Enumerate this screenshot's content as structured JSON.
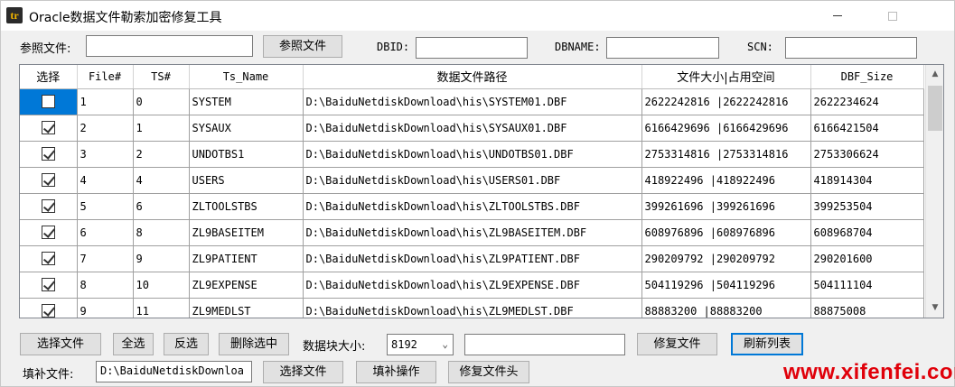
{
  "window": {
    "title": "Oracle数据文件勒索加密修复工具",
    "icon": "app-logo-icon",
    "min_label": "—",
    "max_label": "□"
  },
  "top_form": {
    "ref_file_label": "参照文件:",
    "ref_file_value": "",
    "ref_file_button": "参照文件",
    "dbid_label": "DBID:",
    "dbid_value": "",
    "dbname_label": "DBNAME:",
    "dbname_value": "",
    "scn_label": "SCN:",
    "scn_value": ""
  },
  "grid": {
    "columns": [
      "选择",
      "File#",
      "TS#",
      "Ts_Name",
      "数据文件路径",
      "文件大小|占用空间",
      "DBF_Size"
    ],
    "rows": [
      {
        "checked": false,
        "selected": true,
        "file": "1",
        "ts": "0",
        "ts_name": "SYSTEM",
        "path": "D:\\BaiduNetdiskDownload\\his\\SYSTEM01.DBF",
        "size": "2622242816 |2622242816",
        "dbf_size": "2622234624"
      },
      {
        "checked": true,
        "selected": false,
        "file": "2",
        "ts": "1",
        "ts_name": "SYSAUX",
        "path": "D:\\BaiduNetdiskDownload\\his\\SYSAUX01.DBF",
        "size": "6166429696 |6166429696",
        "dbf_size": "6166421504"
      },
      {
        "checked": true,
        "selected": false,
        "file": "3",
        "ts": "2",
        "ts_name": "UNDOTBS1",
        "path": "D:\\BaiduNetdiskDownload\\his\\UNDOTBS01.DBF",
        "size": "2753314816 |2753314816",
        "dbf_size": "2753306624"
      },
      {
        "checked": true,
        "selected": false,
        "file": "4",
        "ts": "4",
        "ts_name": "USERS",
        "path": "D:\\BaiduNetdiskDownload\\his\\USERS01.DBF",
        "size": "418922496 |418922496",
        "dbf_size": "418914304"
      },
      {
        "checked": true,
        "selected": false,
        "file": "5",
        "ts": "6",
        "ts_name": "ZLTOOLSTBS",
        "path": "D:\\BaiduNetdiskDownload\\his\\ZLTOOLSTBS.DBF",
        "size": "399261696 |399261696",
        "dbf_size": "399253504"
      },
      {
        "checked": true,
        "selected": false,
        "file": "6",
        "ts": "8",
        "ts_name": "ZL9BASEITEM",
        "path": "D:\\BaiduNetdiskDownload\\his\\ZL9BASEITEM.DBF",
        "size": "608976896 |608976896",
        "dbf_size": "608968704"
      },
      {
        "checked": true,
        "selected": false,
        "file": "7",
        "ts": "9",
        "ts_name": "ZL9PATIENT",
        "path": "D:\\BaiduNetdiskDownload\\his\\ZL9PATIENT.DBF",
        "size": "290209792 |290209792",
        "dbf_size": "290201600"
      },
      {
        "checked": true,
        "selected": false,
        "file": "8",
        "ts": "10",
        "ts_name": "ZL9EXPENSE",
        "path": "D:\\BaiduNetdiskDownload\\his\\ZL9EXPENSE.DBF",
        "size": "504119296 |504119296",
        "dbf_size": "504111104"
      },
      {
        "checked": true,
        "selected": false,
        "file": "9",
        "ts": "11",
        "ts_name": "ZL9MEDLST",
        "path": "D:\\BaiduNetdiskDownload\\his\\ZL9MEDLST.DBF",
        "size": "88883200 |88883200",
        "dbf_size": "88875008"
      }
    ],
    "scroll_up": "▲",
    "scroll_down": "▼"
  },
  "actions": {
    "select_file": "选择文件",
    "select_all": "全选",
    "invert": "反选",
    "delete_selected": "删除选中",
    "block_size_label": "数据块大小:",
    "block_size_value": "8192",
    "extra_value": "",
    "repair_file": "修复文件",
    "refresh_list": "刷新列表"
  },
  "fill": {
    "label": "填补文件:",
    "path_value": "D:\\BaiduNetdiskDownloa",
    "select_file": "选择文件",
    "fill_op": "填补操作",
    "repair_header": "修复文件头"
  },
  "watermark": "www.xifenfei.com"
}
